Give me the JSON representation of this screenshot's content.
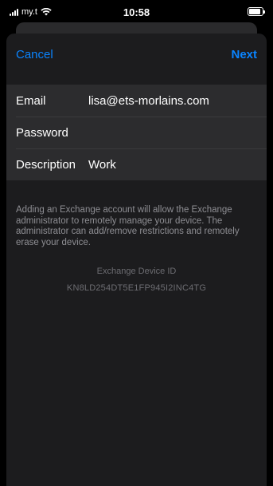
{
  "status_bar": {
    "carrier": "my.t",
    "time": "10:58",
    "signal_icon": "signal-icon",
    "wifi_icon": "wifi-icon",
    "battery_icon": "battery-icon",
    "battery_level": 1.0
  },
  "nav": {
    "cancel_label": "Cancel",
    "next_label": "Next",
    "accent_color": "#0a84ff"
  },
  "form": {
    "fields": [
      {
        "label": "Email",
        "value": "lisa@ets-morlains.com"
      },
      {
        "label": "Password",
        "value": ""
      },
      {
        "label": "Description",
        "value": "Work"
      }
    ]
  },
  "info": {
    "note": "Adding an Exchange account will allow the Exchange administrator to remotely manage your device. The administrator can add/remove restrictions and remotely erase your device.",
    "device_id_title": "Exchange Device ID",
    "device_id_value": "KN8LD254DT5E1FP945I2INC4TG"
  }
}
